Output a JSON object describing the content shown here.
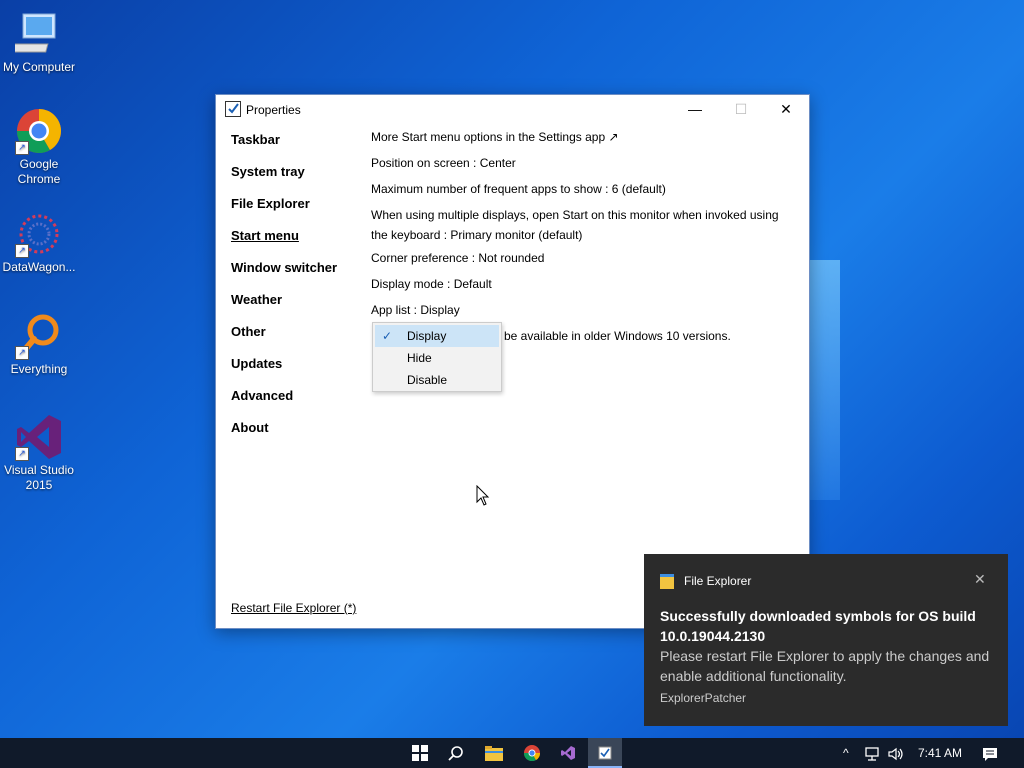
{
  "desktop": {
    "icons": [
      {
        "label": "My Computer"
      },
      {
        "label": "Google\nChrome"
      },
      {
        "label": "DataWagon..."
      },
      {
        "label": "Everything"
      },
      {
        "label": "Visual Studio\n2015"
      }
    ]
  },
  "window": {
    "title": "Properties",
    "controls": {
      "minimize": "—",
      "maximize": "☐",
      "close": "✕"
    },
    "nav": [
      "Taskbar",
      "System tray",
      "File Explorer",
      "Start menu",
      "Window switcher",
      "Weather",
      "Other",
      "Updates",
      "Advanced",
      "About"
    ],
    "active_nav": "Start menu",
    "restart_link": "Restart File Explorer (*)",
    "options": {
      "settings_link": "More Start menu options in the Settings app ↗",
      "position": "Position on screen : Center",
      "frequent": "Maximum number of frequent apps to show : 6 (default)",
      "multi_display": "When using multiple displays, open Start on this monitor when invoked using the keyboard : Primary monitor (default)",
      "corner": "Corner preference : Not rounded",
      "display_mode": "Display mode : Default",
      "app_list": "App list : Display",
      "tail_text": "be available in older Windows 10 versions."
    },
    "dropdown": {
      "items": [
        "Display",
        "Hide",
        "Disable"
      ],
      "selected": "Display",
      "check": "✓"
    }
  },
  "notification": {
    "app": "File Explorer",
    "close": "✕",
    "heading": "Successfully downloaded symbols for OS build 10.0.19044.2130",
    "body": "Please restart File Explorer to apply the changes and enable additional functionality.",
    "source": "ExplorerPatcher"
  },
  "taskbar": {
    "clock": "7:41 AM",
    "tray_chevron": "^",
    "volume_icon": "🔊",
    "notif_icon": "▤"
  }
}
